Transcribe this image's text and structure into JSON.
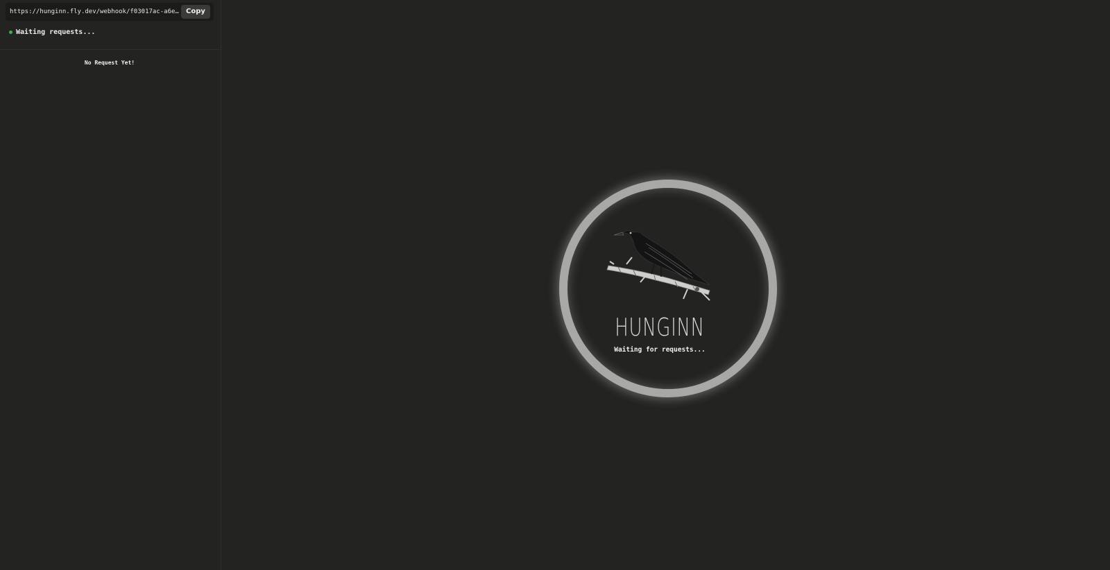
{
  "sidebar": {
    "url": "https://hunginn.fly.dev/webhook/f03017ac-a6e9-4914-...",
    "copy_label": "Copy",
    "status_text": "Waiting requests...",
    "status_color": "#3fae55",
    "empty_text": "No Request Yet!"
  },
  "main": {
    "logo_icon": "raven-on-branch-icon",
    "brand_name": "HUNGINN",
    "status_text": "Waiting for requests..."
  },
  "colors": {
    "background": "#232321",
    "ring": "#a8a8a6"
  }
}
